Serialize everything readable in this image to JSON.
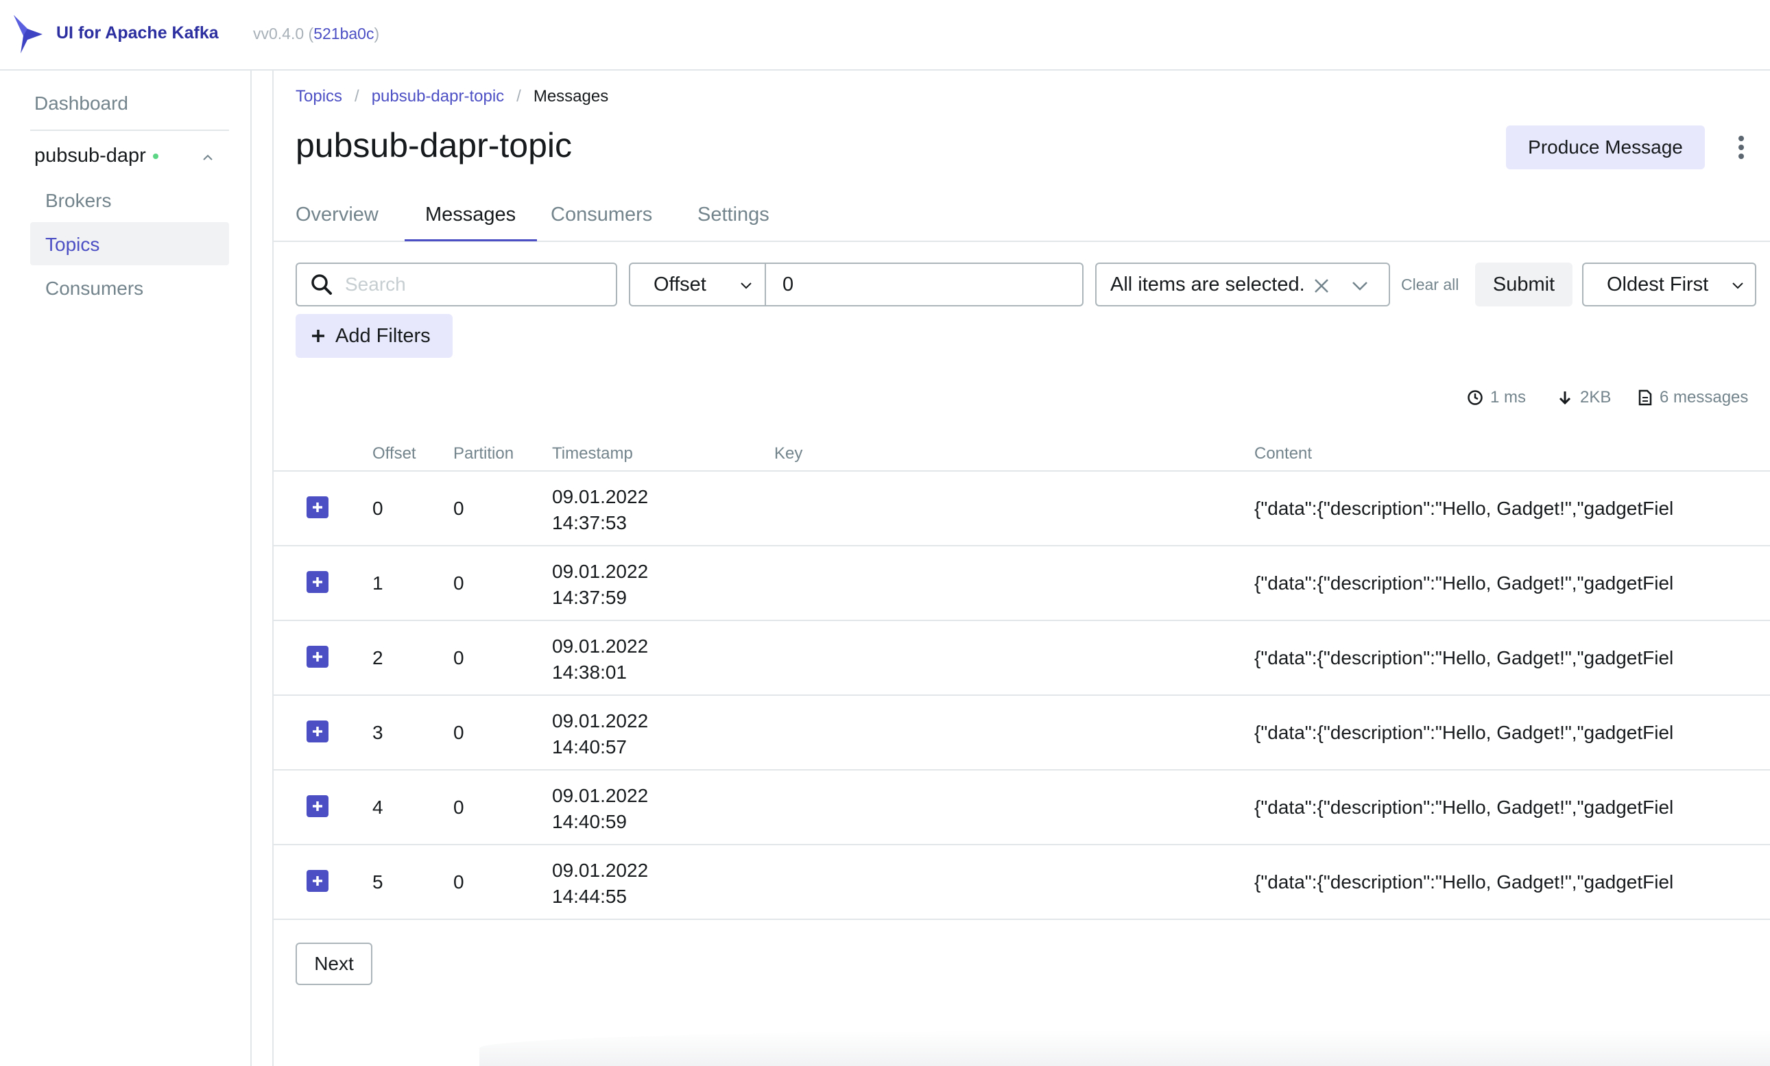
{
  "header": {
    "brand": "UI for Apache Kafka",
    "version_prefix": "vv0.4.0 (",
    "version_commit": "521ba0c",
    "version_suffix": ")"
  },
  "sidebar": {
    "dashboard": "Dashboard",
    "cluster": "pubsub-dapr",
    "items": [
      {
        "label": "Brokers",
        "active": false
      },
      {
        "label": "Topics",
        "active": true
      },
      {
        "label": "Consumers",
        "active": false
      }
    ]
  },
  "breadcrumb": {
    "items": [
      "Topics",
      "pubsub-dapr-topic",
      "Messages"
    ],
    "separator": "/"
  },
  "page": {
    "title": "pubsub-dapr-topic",
    "produce_label": "Produce Message"
  },
  "tabs": [
    {
      "label": "Overview",
      "active": false
    },
    {
      "label": "Messages",
      "active": true
    },
    {
      "label": "Consumers",
      "active": false
    },
    {
      "label": "Settings",
      "active": false
    }
  ],
  "filters": {
    "search_placeholder": "Search",
    "seek_type": "Offset",
    "offset_value": "0",
    "partitions_label": "All items are selected.",
    "clear_all": "Clear all",
    "submit": "Submit",
    "sort": "Oldest First",
    "add_filters": "Add Filters"
  },
  "stats": {
    "elapsed": "1 ms",
    "bytes": "2KB",
    "messages": "6 messages"
  },
  "table": {
    "columns": [
      "Offset",
      "Partition",
      "Timestamp",
      "Key",
      "Content"
    ],
    "rows": [
      {
        "offset": "0",
        "partition": "0",
        "date": "09.01.2022",
        "time": "14:37:53",
        "key": "",
        "content": "{\"data\":{\"description\":\"Hello, Gadget!\",\"gadgetFiel"
      },
      {
        "offset": "1",
        "partition": "0",
        "date": "09.01.2022",
        "time": "14:37:59",
        "key": "",
        "content": "{\"data\":{\"description\":\"Hello, Gadget!\",\"gadgetFiel"
      },
      {
        "offset": "2",
        "partition": "0",
        "date": "09.01.2022",
        "time": "14:38:01",
        "key": "",
        "content": "{\"data\":{\"description\":\"Hello, Gadget!\",\"gadgetFiel"
      },
      {
        "offset": "3",
        "partition": "0",
        "date": "09.01.2022",
        "time": "14:40:57",
        "key": "",
        "content": "{\"data\":{\"description\":\"Hello, Gadget!\",\"gadgetFiel"
      },
      {
        "offset": "4",
        "partition": "0",
        "date": "09.01.2022",
        "time": "14:40:59",
        "key": "",
        "content": "{\"data\":{\"description\":\"Hello, Gadget!\",\"gadgetFiel"
      },
      {
        "offset": "5",
        "partition": "0",
        "date": "09.01.2022",
        "time": "14:44:55",
        "key": "",
        "content": "{\"data\":{\"description\":\"Hello, Gadget!\",\"gadgetFiel"
      }
    ]
  },
  "pagination": {
    "next": "Next"
  },
  "colors": {
    "accent": "#4c4fc4",
    "brand": "#2c2fa0",
    "online": "#5cd685"
  }
}
